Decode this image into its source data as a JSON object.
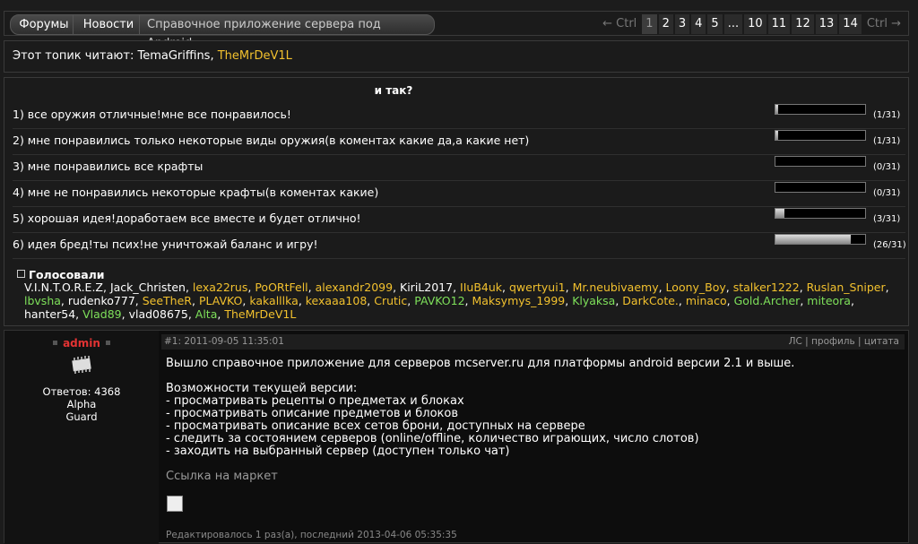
{
  "nav": {
    "forums": "Форумы",
    "news": "Новости",
    "current": "Справочное приложение сервера под Android"
  },
  "pager": {
    "prev": "← Ctrl",
    "pages": [
      "1",
      "2",
      "3",
      "4",
      "5",
      "...",
      "10",
      "11",
      "12",
      "13",
      "14"
    ],
    "current_page": "1",
    "next": "Ctrl →"
  },
  "readers": {
    "label": "Этот топик читают:",
    "users": [
      "TemaGriffins",
      "TheMrDeV1L"
    ]
  },
  "poll": {
    "question": "и так?",
    "total": 31,
    "options": [
      {
        "label": "1) все оружия отличные!мне все понравилось!",
        "count": "(1/31)",
        "votes": 1
      },
      {
        "label": "2) мне понравились только некоторые виды оружия(в коментах какие да,а какие нет)",
        "count": "(1/31)",
        "votes": 1
      },
      {
        "label": "3) мне понравились все крафты",
        "count": "(0/31)",
        "votes": 0
      },
      {
        "label": "4) мне не понравились некоторые крафты(в коментах какие)",
        "count": "(0/31)",
        "votes": 0
      },
      {
        "label": "5) хорошая идея!доработаем все вместе и будет отлично!",
        "count": "(3/31)",
        "votes": 3
      },
      {
        "label": "6) идея бред!ты псих!не уничтожай баланс и игру!",
        "count": "(26/31)",
        "votes": 26
      }
    ],
    "voters_title": "Голосовали",
    "voters": [
      {
        "name": "V.I.N.T.O.R.E.Z",
        "color": "#ffffff"
      },
      {
        "name": "Jack_Christen",
        "color": "#ffffff"
      },
      {
        "name": "lexa22rus",
        "color": "#f2c12e"
      },
      {
        "name": "PoORtFell",
        "color": "#f2c12e"
      },
      {
        "name": "alexandr2099",
        "color": "#f2c12e"
      },
      {
        "name": "KiriL2017",
        "color": "#ffffff"
      },
      {
        "name": "IIuB4uk",
        "color": "#f2c12e"
      },
      {
        "name": "qwertyui1",
        "color": "#f2c12e"
      },
      {
        "name": "Mr.neubivaemy",
        "color": "#f2c12e"
      },
      {
        "name": "Loony_Boy",
        "color": "#f2c12e"
      },
      {
        "name": "stalker1222",
        "color": "#f2c12e"
      },
      {
        "name": "Ruslan_Sniper",
        "color": "#f2c12e"
      },
      {
        "name": "lbvsha",
        "color": "#7ee05a"
      },
      {
        "name": "rudenko777",
        "color": "#ffffff"
      },
      {
        "name": "SeeTheR",
        "color": "#f2c12e"
      },
      {
        "name": "PLAVKO",
        "color": "#f2c12e"
      },
      {
        "name": "kakalllka",
        "color": "#f2c12e"
      },
      {
        "name": "kexaaa108",
        "color": "#f2c12e"
      },
      {
        "name": "Crutic",
        "color": "#f2c12e"
      },
      {
        "name": "PAVKO12",
        "color": "#7ee05a"
      },
      {
        "name": "Maksymys_1999",
        "color": "#f2c12e"
      },
      {
        "name": "Klyaksa",
        "color": "#7ee05a"
      },
      {
        "name": "DarkCote.",
        "color": "#f2c12e"
      },
      {
        "name": "minaco",
        "color": "#f2c12e"
      },
      {
        "name": "Gold.Archer",
        "color": "#7ee05a"
      },
      {
        "name": "miteora",
        "color": "#7ee05a"
      },
      {
        "name": "hanter54",
        "color": "#ffffff"
      },
      {
        "name": "Vlad89",
        "color": "#7ee05a"
      },
      {
        "name": "vlad08675",
        "color": "#ffffff"
      },
      {
        "name": "Alta",
        "color": "#7ee05a"
      },
      {
        "name": "TheMrDeV1L",
        "color": "#f2c12e"
      }
    ]
  },
  "post": {
    "author": "admin",
    "author_color": "#e33333",
    "replies": "Ответов: 4368",
    "rank1": "Alpha",
    "rank2": "Guard",
    "meta": "#1: 2011-09-05 11:35:01",
    "links": "ЛС | профиль | цитата",
    "body_lines": [
      "Вышло справочное приложение для серверов mcserver.ru для платформы android версии 2.1 и выше.",
      "",
      "Возможности текущей версии:",
      "- просматривать рецепты о предметах и блоках",
      "- просматривать описание предметов и блоков",
      "- просматривать описание всех сетов брони, доступных на сервере",
      "- следить за состоянием серверов (online/offline, количество играющих, число слотов)",
      "- заходить на выбранный сервер (доступен только чат)"
    ],
    "link_text": "Ссылка на маркет",
    "edited": "Редактировалось 1 раз(а), последний 2013-04-06 05:35:35"
  }
}
